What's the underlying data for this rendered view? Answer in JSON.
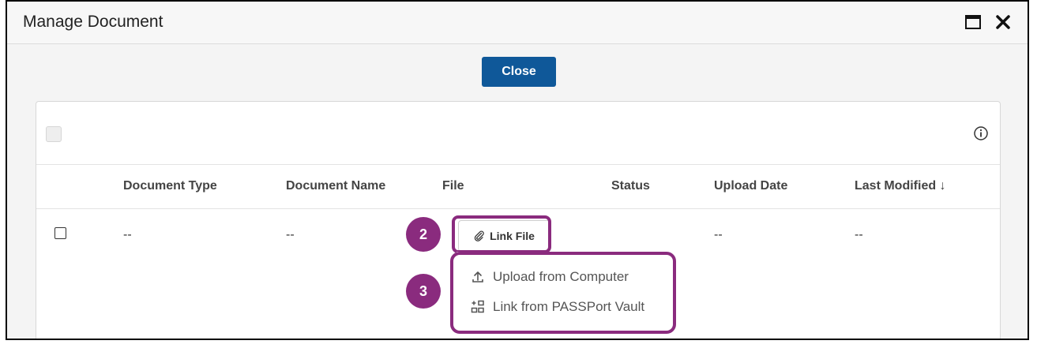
{
  "dialog": {
    "title": "Manage Document",
    "close_label": "Close"
  },
  "table": {
    "columns": [
      "Document Type",
      "Document Name",
      "File",
      "Status",
      "Upload Date",
      "Last Modified ↓"
    ],
    "row": {
      "document_type": "--",
      "document_name": "--",
      "upload_date": "--",
      "last_modified": "--",
      "link_file_label": "Link File"
    }
  },
  "menu": {
    "items": [
      "Upload from Computer",
      "Link from PASSPort Vault"
    ]
  },
  "callouts": [
    "2",
    "3"
  ],
  "colors": {
    "accent": "#8a2b7e",
    "primary_button": "#0f5899"
  }
}
